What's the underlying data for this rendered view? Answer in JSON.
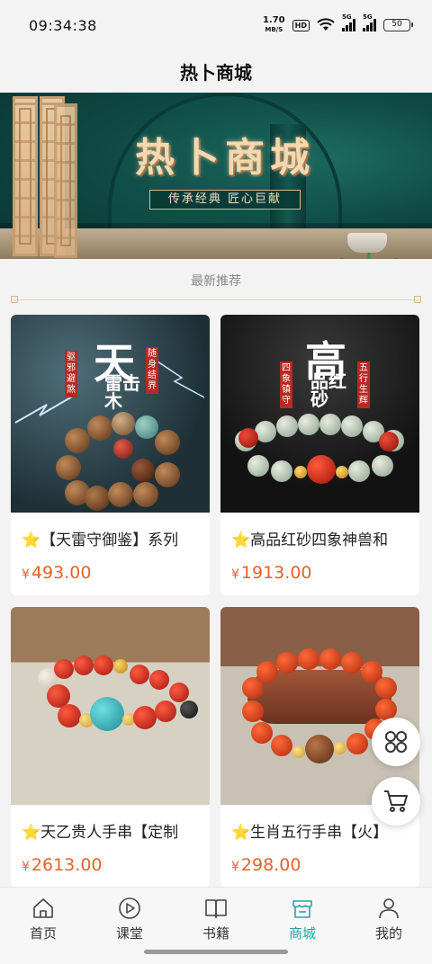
{
  "status_bar": {
    "time": "09:34:38",
    "net_speed_value": "1.70",
    "net_speed_unit": "MB/S",
    "hd": "HD",
    "sig1": "5G",
    "sig2": "5G",
    "battery": "50"
  },
  "header": {
    "title": "热卜商城"
  },
  "banner": {
    "title": "热卜商城",
    "slogan": "传承经典 匠心巨献"
  },
  "section": {
    "title": "最新推荐"
  },
  "products": [
    {
      "name": "⭐【天雷守御鉴】系列",
      "currency": "¥",
      "price": "493.00",
      "art": {
        "big": "天",
        "sub": "雷击木",
        "left": "驱邪避煞",
        "right": "随身结界"
      }
    },
    {
      "name": "⭐高品红砂四象神兽和",
      "currency": "¥",
      "price": "1913.00",
      "art": {
        "big": "高",
        "sub": "品红砂",
        "left": "四象镇守",
        "right": "五行生辉"
      }
    },
    {
      "name": "⭐天乙贵人手串【定制",
      "currency": "¥",
      "price": "2613.00"
    },
    {
      "name": "⭐生肖五行手串【火】",
      "currency": "¥",
      "price": "298.00"
    }
  ],
  "fab": {
    "grid_icon": "grid-icon",
    "cart_icon": "cart-icon"
  },
  "nav": {
    "active_color": "#23a7a3",
    "items": [
      {
        "label": "首页",
        "icon": "home-icon"
      },
      {
        "label": "课堂",
        "icon": "play-icon"
      },
      {
        "label": "书籍",
        "icon": "book-icon"
      },
      {
        "label": "商城",
        "icon": "store-icon",
        "active": true
      },
      {
        "label": "我的",
        "icon": "user-icon"
      }
    ]
  }
}
